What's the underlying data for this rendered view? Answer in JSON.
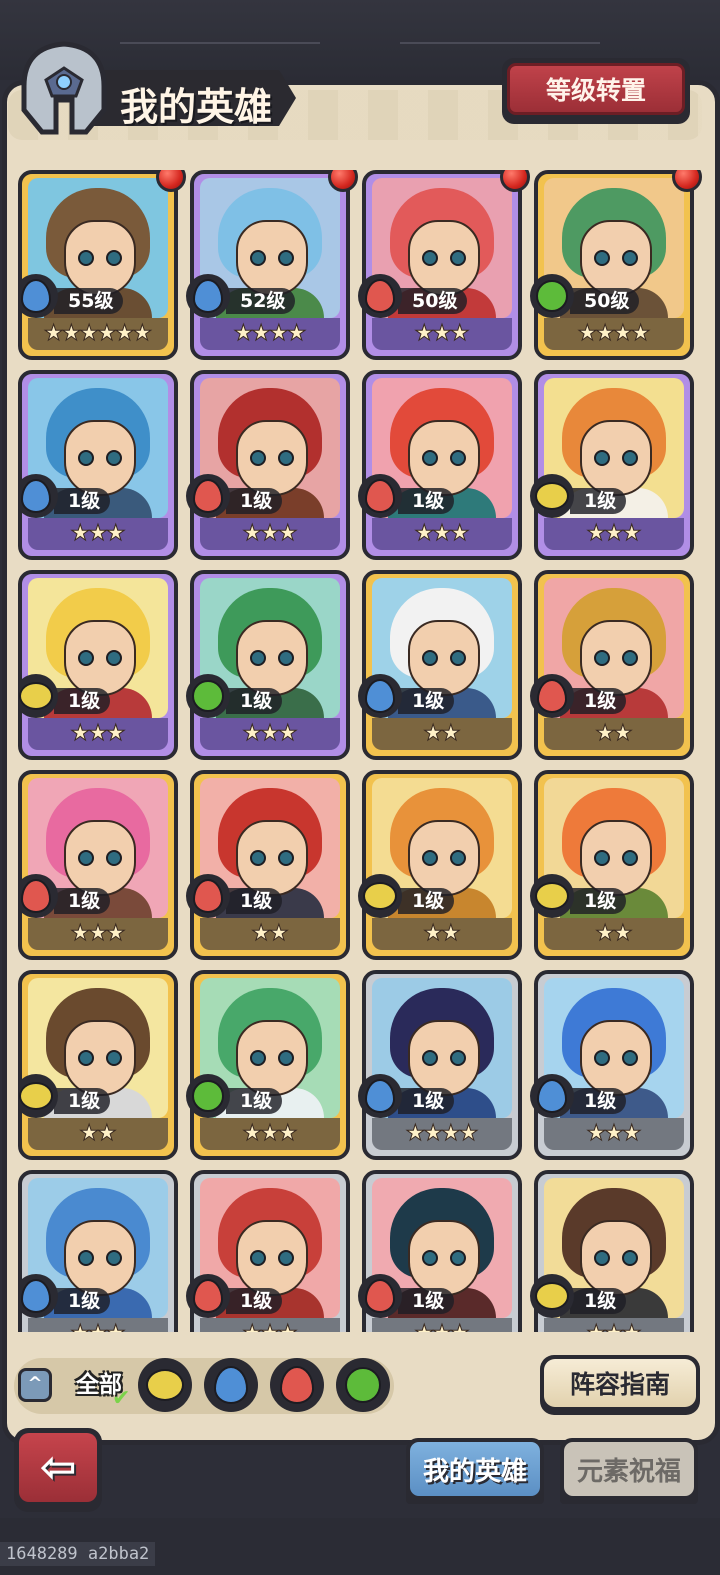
{
  "header": {
    "title": "我的英雄",
    "reset_button": "等级转置"
  },
  "colors": {
    "water": "#4f8fd6",
    "fire": "#e0574f",
    "wind": "#5dbb3a",
    "earth": "#e8cf4a",
    "rarity_gold": "#f2c24e",
    "rarity_purple": "#b18ee6",
    "rarity_silver": "#c8ccd2"
  },
  "heroes": [
    {
      "level": "55级",
      "stars": "★★★★★★",
      "element": "water",
      "rarity": "gold",
      "badge": true,
      "bg": "#7fc6e0",
      "hair": "#7a5a3a",
      "body": "#6a4e33"
    },
    {
      "level": "52级",
      "stars": "★★★★",
      "element": "water",
      "rarity": "purple",
      "badge": true,
      "bg": "#a9c7e6",
      "hair": "#7fc0e6",
      "body": "#4b8a4a"
    },
    {
      "level": "50级",
      "stars": "★★★",
      "element": "fire",
      "rarity": "purple",
      "badge": true,
      "bg": "#e9a0b0",
      "hair": "#e25a5a",
      "body": "#c23a3a"
    },
    {
      "level": "50级",
      "stars": "★★★★",
      "element": "wind",
      "rarity": "gold",
      "badge": true,
      "bg": "#f1c88a",
      "hair": "#4e9a62",
      "body": "#6b5238"
    },
    {
      "level": "1级",
      "stars": "★★★",
      "element": "water",
      "rarity": "purple",
      "badge": false,
      "bg": "#89c6e8",
      "hair": "#3f8fc9",
      "body": "#3a5a7c"
    },
    {
      "level": "1级",
      "stars": "★★★",
      "element": "fire",
      "rarity": "purple",
      "badge": false,
      "bg": "#e7a4a4",
      "hair": "#b2302e",
      "body": "#7a3e2a"
    },
    {
      "level": "1级",
      "stars": "★★★",
      "element": "fire",
      "rarity": "purple",
      "badge": false,
      "bg": "#f0a2ae",
      "hair": "#e24a3a",
      "body": "#2e7a7a"
    },
    {
      "level": "1级",
      "stars": "★★★",
      "element": "earth",
      "rarity": "purple",
      "badge": false,
      "bg": "#f3df90",
      "hair": "#e8883a",
      "body": "#f4f0e6"
    },
    {
      "level": "1级",
      "stars": "★★★",
      "element": "earth",
      "rarity": "purple",
      "badge": false,
      "bg": "#f4e59a",
      "hair": "#f2cc4a",
      "body": "#b83a3a"
    },
    {
      "level": "1级",
      "stars": "★★★",
      "element": "wind",
      "rarity": "purple",
      "badge": false,
      "bg": "#9ad6c8",
      "hair": "#3e9a5a",
      "body": "#3a6e4a"
    },
    {
      "level": "1级",
      "stars": "★★",
      "element": "water",
      "rarity": "gold",
      "badge": false,
      "bg": "#9ed2e8",
      "hair": "#f2f2f2",
      "body": "#3a5a8a"
    },
    {
      "level": "1级",
      "stars": "★★",
      "element": "fire",
      "rarity": "gold",
      "badge": false,
      "bg": "#f0a6a6",
      "hair": "#d6a03a",
      "body": "#b83a3a"
    },
    {
      "level": "1级",
      "stars": "★★★",
      "element": "fire",
      "rarity": "gold",
      "badge": false,
      "bg": "#f0a6b6",
      "hair": "#e86aa0",
      "body": "#7a4a3a"
    },
    {
      "level": "1级",
      "stars": "★★",
      "element": "fire",
      "rarity": "gold",
      "badge": false,
      "bg": "#f2b0a8",
      "hair": "#c8362e",
      "body": "#3a3a4a"
    },
    {
      "level": "1级",
      "stars": "★★",
      "element": "earth",
      "rarity": "gold",
      "badge": false,
      "bg": "#f4dc92",
      "hair": "#e8923a",
      "body": "#c8862e"
    },
    {
      "level": "1级",
      "stars": "★★",
      "element": "earth",
      "rarity": "gold",
      "badge": false,
      "bg": "#f2d896",
      "hair": "#ee7a3a",
      "body": "#6a8a3a"
    },
    {
      "level": "1级",
      "stars": "★★",
      "element": "earth",
      "rarity": "gold",
      "badge": false,
      "bg": "#f4e6a0",
      "hair": "#6a4a2e",
      "body": "#d8d8d8"
    },
    {
      "level": "1级",
      "stars": "★★★",
      "element": "wind",
      "rarity": "gold",
      "badge": false,
      "bg": "#a6dcb6",
      "hair": "#48a86a",
      "body": "#e8f0f0"
    },
    {
      "level": "1级",
      "stars": "★★★★",
      "element": "water",
      "rarity": "silver",
      "badge": false,
      "bg": "#9ccbe6",
      "hair": "#2a2a5a",
      "body": "#2e4e8a"
    },
    {
      "level": "1级",
      "stars": "★★★",
      "element": "water",
      "rarity": "silver",
      "badge": false,
      "bg": "#a6d4ee",
      "hair": "#3e7ad6",
      "body": "#3e5a8a"
    },
    {
      "level": "1级",
      "stars": "★★★",
      "element": "water",
      "rarity": "silver",
      "badge": false,
      "bg": "#9ccce8",
      "hair": "#4a8ad0",
      "body": "#3a6ab0"
    },
    {
      "level": "1级",
      "stars": "★★★",
      "element": "fire",
      "rarity": "silver",
      "badge": false,
      "bg": "#f0a8a8",
      "hair": "#c8403a",
      "body": "#a8342e"
    },
    {
      "level": "1级",
      "stars": "★★★",
      "element": "fire",
      "rarity": "silver",
      "badge": false,
      "bg": "#f0aab0",
      "hair": "#1e3a4a",
      "body": "#5a2a2a"
    },
    {
      "level": "1级",
      "stars": "★★★",
      "element": "earth",
      "rarity": "silver",
      "badge": false,
      "bg": "#f2dc98",
      "hair": "#5a3a2a",
      "body": "#3a3a3a"
    }
  ],
  "filters": {
    "all_label": "全部",
    "elements": [
      "earth",
      "water",
      "fire",
      "wind"
    ]
  },
  "buttons": {
    "guide": "阵容指南",
    "back_icon": "back-arrow-icon"
  },
  "tabs": [
    {
      "label": "我的英雄",
      "active": true
    },
    {
      "label": "元素祝福",
      "active": false
    }
  ],
  "footer": {
    "build_id": "1648289 a2bba2"
  }
}
